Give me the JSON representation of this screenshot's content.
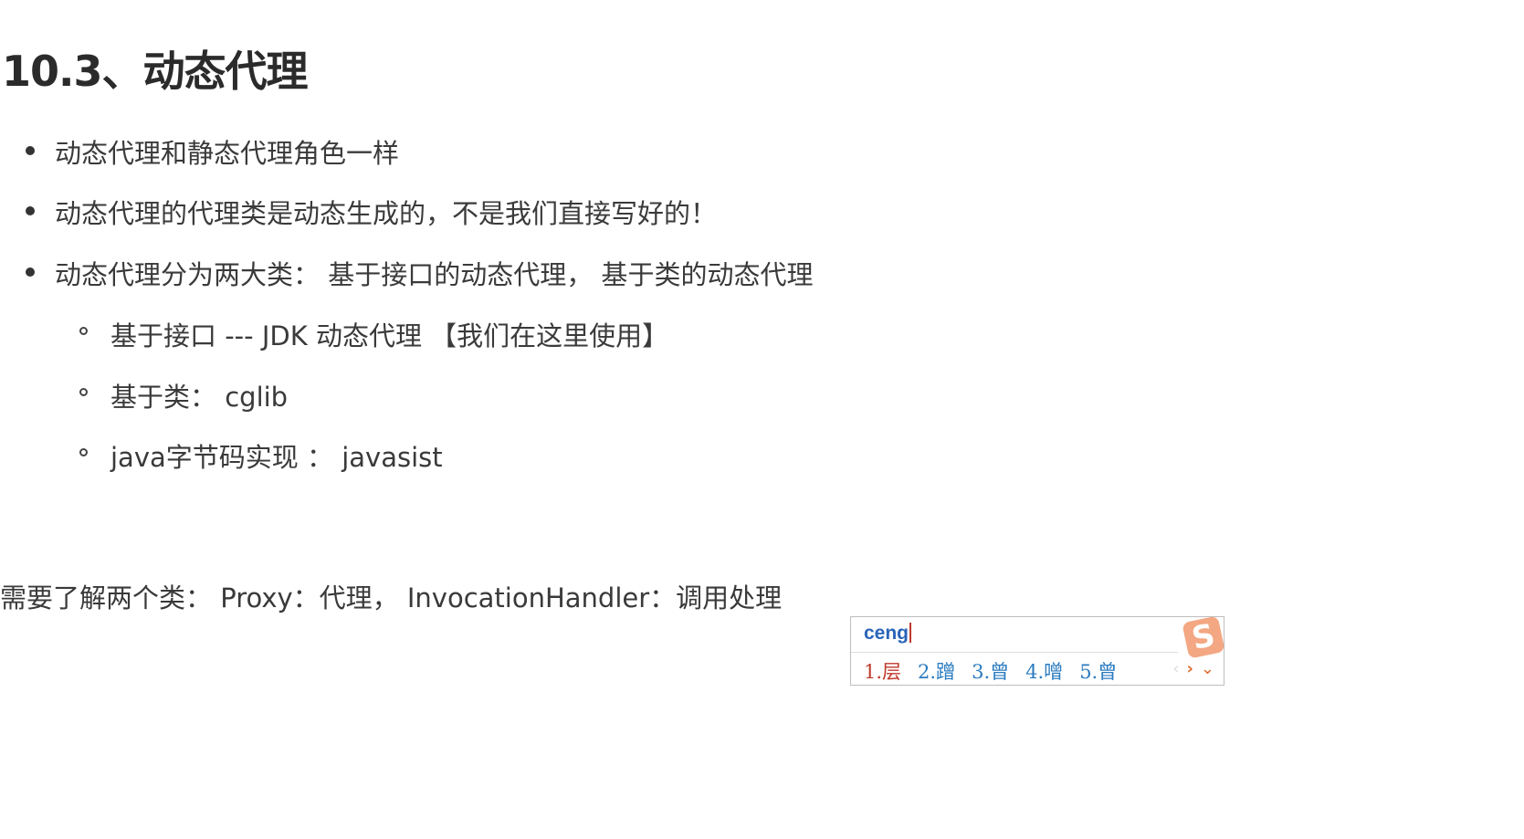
{
  "heading": "10.3、动态代理",
  "bullets": [
    "动态代理和静态代理角色一样",
    "动态代理的代理类是动态生成的，不是我们直接写好的！",
    "动态代理分为两大类： 基于接口的动态代理， 基于类的动态代理"
  ],
  "sub_bullets": [
    "基于接口 --- JDK 动态代理 【我们在这里使用】",
    "基于类： cglib",
    "java字节码实现 ： javasist"
  ],
  "note": "需要了解两个类： Proxy：代理， InvocationHandler：调用处理",
  "ime": {
    "input": "ceng",
    "candidates": [
      "1.层",
      "2.蹭",
      "3.曾",
      "4.噌",
      "5.曾"
    ],
    "logo": "S",
    "prev": "‹",
    "next": "›",
    "more": "⌄"
  }
}
